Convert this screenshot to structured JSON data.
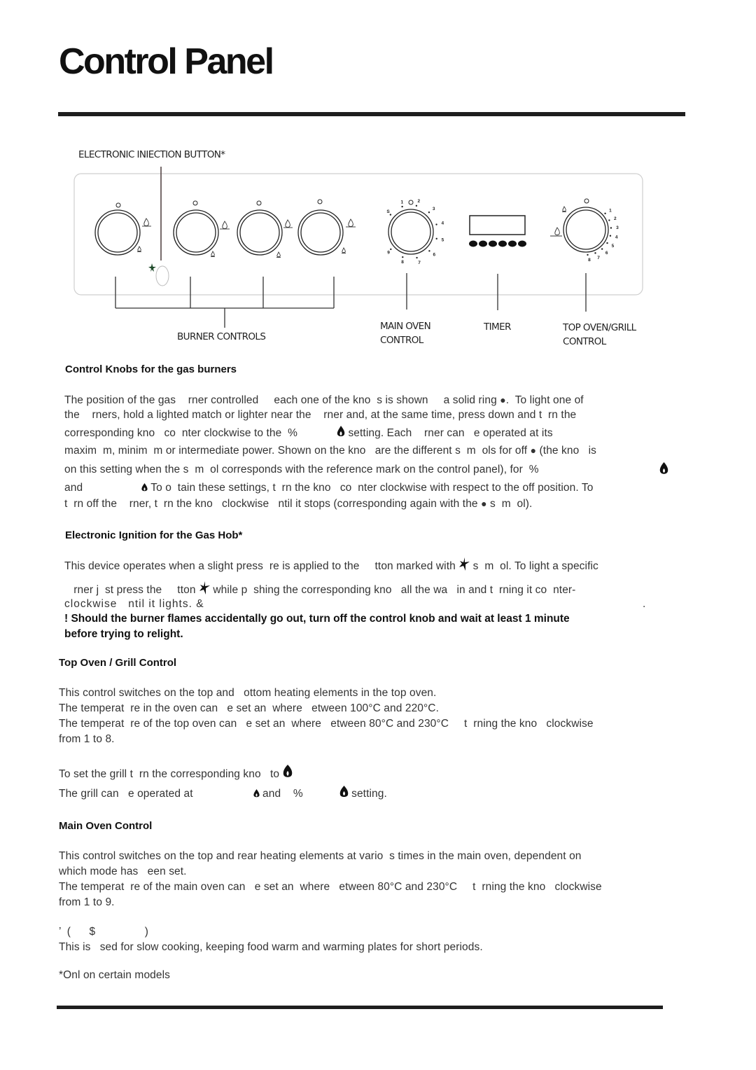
{
  "page": {
    "title": "Control Panel"
  },
  "diagram": {
    "ignition_label": "ELECTRONIC INIECTION BUTTON*",
    "burner_controls_label": "BURNER CONTROLS",
    "main_oven_label_line1": "MAIN OVEN",
    "main_oven_label_line2": "CONTROL",
    "timer_label": "TIMER",
    "top_oven_label_line1": "TOP OVEN/GRILL",
    "top_oven_label_line2": "CONTROL",
    "burner_knob_count": 4,
    "timer_button_count": 6,
    "main_oven_dial_marks": [
      "S",
      "1",
      "2",
      "3",
      "4",
      "5",
      "6",
      "7",
      "8",
      "9"
    ],
    "top_oven_dial_marks": [
      "1",
      "2",
      "3",
      "4",
      "5",
      "6",
      "7",
      "8"
    ],
    "icons": {
      "off_mark": "circle-off-icon",
      "max_flame": "large-flame-icon",
      "min_flame": "small-flame-icon",
      "spark": "spark-icon"
    }
  },
  "sections": {
    "burners": {
      "heading": "Control Knobs for the gas burners",
      "l1a": "The position of the gas    rner controlled     each one of the kno  s is shown     a solid ring ",
      "l1b": ".  To light one of",
      "l2": "the    rners, hold a lighted match or lighter near the    rner and, at the same time, press down and t  rn the",
      "l3a": "corresponding kno   co  nter clockwise to the  %",
      "l3b": " setting. Each    rner can   e operated at its",
      "l4a": "maxim  m, minim  m or intermediate power. Shown on the kno   are the different s  m  ols for off ",
      "l4b": " (the kno   is",
      "l5": "on this setting when the s  m  ol corresponds with the reference mark on the control panel), for  %",
      "l6a": "and",
      "l6b": " To o  tain these settings, t  rn the kno   co  nter clockwise with respect to the off position. To",
      "l7a": "t  rn off the    rner, t  rn the kno   clockwise   ntil it stops (corresponding again with the ",
      "l7b": " s  m  ol)."
    },
    "ignition": {
      "heading": "Electronic Ignition for the Gas Hob*",
      "l1a": "This device operates when a slight press  re is applied to the     tton marked with ",
      "l1b": " s  m  ol. To light a specific",
      "l2a": "   rner j  st press the     tton ",
      "l2b": " while p  shing the corresponding kno   all the wa   in and t  rning it co  nter-",
      "l3": "clockwise   ntil it lights. &",
      "l3_end": ".",
      "warning_line1": "! Should the burner flames accidentally go out, turn off the control knob and wait at least 1 minute",
      "warning_line2": "before trying to relight."
    },
    "top_oven": {
      "heading": "Top Oven / Grill Control",
      "l1": "This control switches on the top and   ottom heating elements in the top oven.",
      "l2": "The temperat  re in the oven can   e set an  where   etween 100°C and 220°C.",
      "l3": "The temperat  re of the top oven can   e set an  where   etween 80°C and 230°C     t  rning the kno   clockwise",
      "l4": "from 1 to 8.",
      "grill1": "To set the grill t  rn the corresponding kno   to",
      "grill2a": "The grill can   e operated at",
      "grill2b": "and    %",
      "grill2c": " setting."
    },
    "main_oven": {
      "heading": "Main Oven Control",
      "l1": "This control switches on the top and rear heating elements at vario  s times in the main oven, dependent on",
      "l2": "which mode has   een set.",
      "l3": "The temperat  re of the main oven can   e set an  where   etween 80°C and 230°C     t  rning the kno   clockwise",
      "l4": "from 1 to 9.",
      "slow_heading": "’  (      $                )",
      "slow_text": "This is   sed for slow cooking, keeping food warm and warming plates for short periods."
    },
    "footnote": "*Onl   on certain models"
  }
}
